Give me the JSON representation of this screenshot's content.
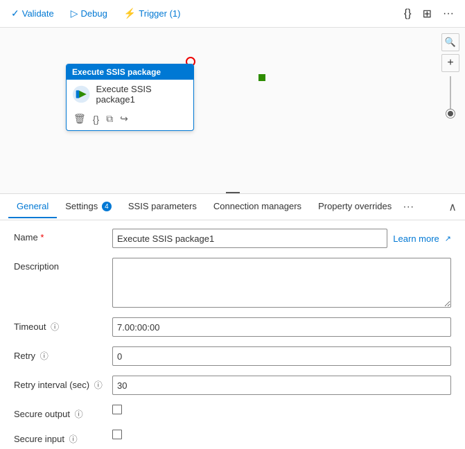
{
  "toolbar": {
    "validate_label": "Validate",
    "debug_label": "Debug",
    "trigger_label": "Trigger (1)"
  },
  "canvas": {
    "card": {
      "header": "Execute SSIS package",
      "activity_name": "Execute SSIS package1"
    }
  },
  "tabs": [
    {
      "id": "general",
      "label": "General",
      "active": true,
      "badge": null
    },
    {
      "id": "settings",
      "label": "Settings",
      "active": false,
      "badge": "4"
    },
    {
      "id": "ssis_parameters",
      "label": "SSIS parameters",
      "active": false,
      "badge": null
    },
    {
      "id": "connection_managers",
      "label": "Connection managers",
      "active": false,
      "badge": null
    },
    {
      "id": "property_overrides",
      "label": "Property overrides",
      "active": false,
      "badge": null
    }
  ],
  "form": {
    "name_label": "Name",
    "name_value": "Execute SSIS package1",
    "learn_more": "Learn more",
    "description_label": "Description",
    "description_value": "",
    "timeout_label": "Timeout",
    "timeout_value": "7.00:00:00",
    "retry_label": "Retry",
    "retry_value": "0",
    "retry_interval_label": "Retry interval (sec)",
    "retry_interval_value": "30",
    "secure_output_label": "Secure output",
    "secure_input_label": "Secure input"
  }
}
